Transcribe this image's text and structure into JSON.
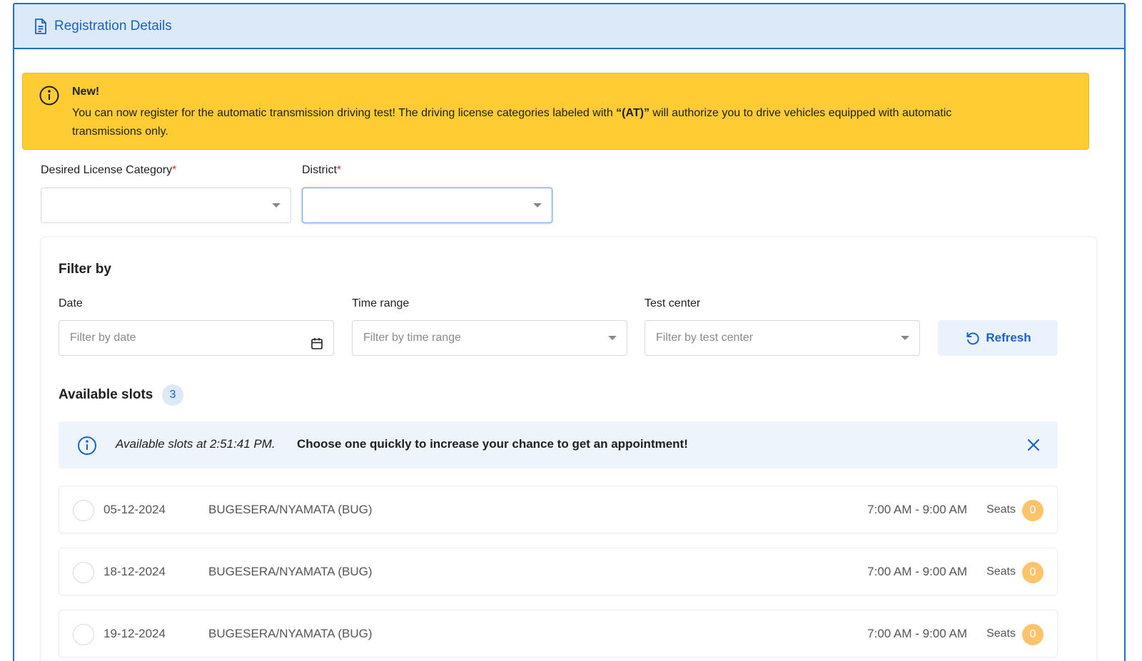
{
  "panel": {
    "title": "Registration Details"
  },
  "notice": {
    "title": "New!",
    "body_prefix": "You can now register for the automatic transmission driving test! The driving license categories labeled with ",
    "body_strong": "“(AT)”",
    "body_suffix": " will authorize you to drive vehicles equipped with automatic transmissions only."
  },
  "form": {
    "category_label": "Desired License Category",
    "district_label": "District",
    "required_mark": "*",
    "category_value": "",
    "district_value": ""
  },
  "filters": {
    "title": "Filter by",
    "date_label": "Date",
    "date_placeholder": "Filter by date",
    "time_label": "Time range",
    "time_placeholder": "Filter by time range",
    "center_label": "Test center",
    "center_placeholder": "Filter by test center",
    "refresh_label": "Refresh"
  },
  "slots": {
    "title": "Available slots",
    "count": "3",
    "alert_text": "Available slots at 2:51:41 PM.",
    "alert_strong": "Choose one quickly to increase your chance to get an appointment!",
    "seats_label": "Seats",
    "items": [
      {
        "date": "05-12-2024",
        "center": "BUGESERA/NYAMATA (BUG)",
        "time": "7:00 AM - 9:00 AM",
        "seats": "0"
      },
      {
        "date": "18-12-2024",
        "center": "BUGESERA/NYAMATA (BUG)",
        "time": "7:00 AM - 9:00 AM",
        "seats": "0"
      },
      {
        "date": "19-12-2024",
        "center": "BUGESERA/NYAMATA (BUG)",
        "time": "7:00 AM - 9:00 AM",
        "seats": "0"
      }
    ]
  },
  "colors": {
    "primary": "#1a63c4",
    "header_bg": "#dbe9f8",
    "notice_bg": "#ffcc33",
    "badge_seats": "#ffc46b",
    "required": "#e03131"
  }
}
